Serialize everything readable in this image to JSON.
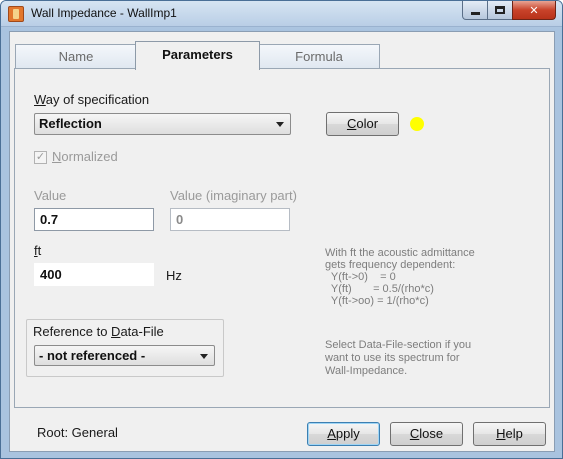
{
  "window": {
    "title": "Wall Impedance - WallImp1",
    "accent_color": "#ffff00"
  },
  "tabs": [
    {
      "label": "Name",
      "active": false
    },
    {
      "label": "Parameters",
      "active": true
    },
    {
      "label": "Formula",
      "active": false
    }
  ],
  "spec": {
    "label_first": "W",
    "label_rest": "ay of specification",
    "selected": "Reflection",
    "color_button_first": "C",
    "color_button_rest": "olor",
    "color_swatch": "#ffff00"
  },
  "normalized": {
    "checked": true,
    "label_first": "N",
    "label_rest": "ormalized"
  },
  "value": {
    "label": "Value",
    "value": "0.7",
    "imag_label": "Value (imaginary part)",
    "imag_value": "0"
  },
  "ft": {
    "label_first": "f",
    "label_rest": "t",
    "value": "400",
    "unit": "Hz"
  },
  "ft_note": "With ft the acoustic admittance\ngets frequency dependent:\n  Y(ft->0)    = 0\n  Y(ft)       = 0.5/(rho*c)\n  Y(ft->oo) = 1/(rho*c)",
  "reference": {
    "label_pre": "Reference to ",
    "label_u": "D",
    "label_post": "ata-File",
    "selected": "- not referenced -"
  },
  "reference_note": "Select Data-File-section if you\nwant to use its spectrum for\nWall-Impedance.",
  "footer": {
    "root_label": "Root: General",
    "apply_first": "A",
    "apply_rest": "pply",
    "close_first": "C",
    "close_rest": "lose",
    "help_first": "H",
    "help_rest": "elp"
  }
}
